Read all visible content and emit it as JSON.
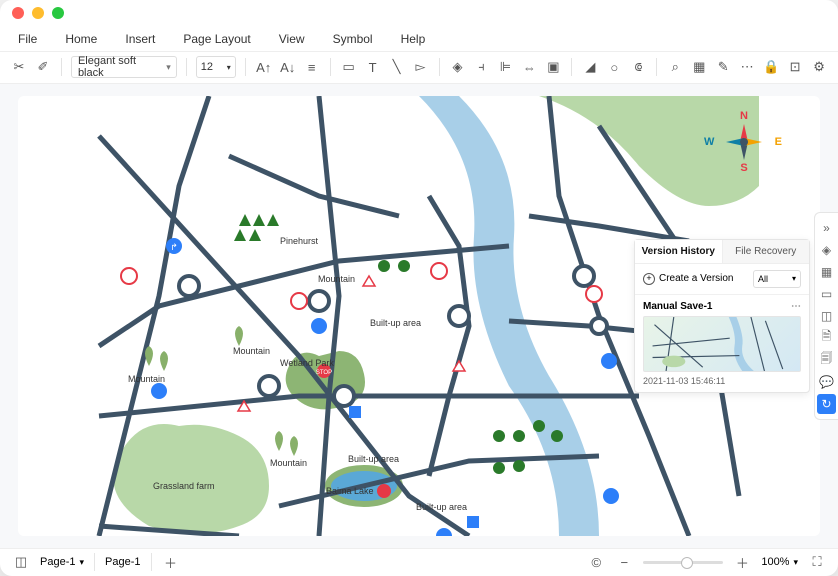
{
  "menu": {
    "file": "File",
    "home": "Home",
    "insert": "Insert",
    "page_layout": "Page Layout",
    "view": "View",
    "symbol": "Symbol",
    "help": "Help"
  },
  "toolbar": {
    "font": "Elegant soft black",
    "size": "12"
  },
  "map_labels": {
    "pinehurst": "Pinehurst",
    "mountain1": "Mountain",
    "mountain2": "Mountain",
    "mountain3": "Mountain",
    "mountain4": "Mountain",
    "builtup1": "Built-up area",
    "builtup2": "Built-up area",
    "builtup3": "Built-up area",
    "wetland": "Wetland Park",
    "grassland": "Grassland farm",
    "lake": "Baima Lake"
  },
  "compass": {
    "n": "N",
    "s": "S",
    "e": "E",
    "w": "W"
  },
  "panel": {
    "tab_history": "Version History",
    "tab_recovery": "File Recovery",
    "create": "Create a Version",
    "filter": "All",
    "version_name": "Manual Save-1",
    "version_date": "2021-11-03 15:46:11"
  },
  "status": {
    "page_select": "Page-1",
    "page_tab": "Page-1",
    "zoom": "100%"
  }
}
